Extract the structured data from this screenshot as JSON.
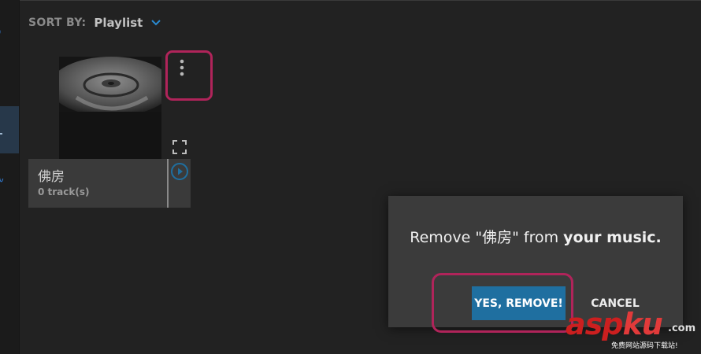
{
  "sort": {
    "label": "SORT BY:",
    "value": "Playlist"
  },
  "playlist_card": {
    "title": "佛房",
    "track_count": "0 track(s)"
  },
  "dialog": {
    "message_prefix": "Remove \"佛房\" from ",
    "message_strong": "your music.",
    "confirm_label": "YES, REMOVE!",
    "cancel_label": "CANCEL"
  },
  "watermark": {
    "main": "asp",
    "main_accent": "ku",
    "suffix": ".com",
    "sub": "免费网站源码下载站!"
  },
  "colors": {
    "background": "#222222",
    "dialog": "#3b3b3b",
    "accent_button": "#1f6fa0",
    "highlight_border": "#b0245a",
    "rail_active": "#27384a"
  }
}
